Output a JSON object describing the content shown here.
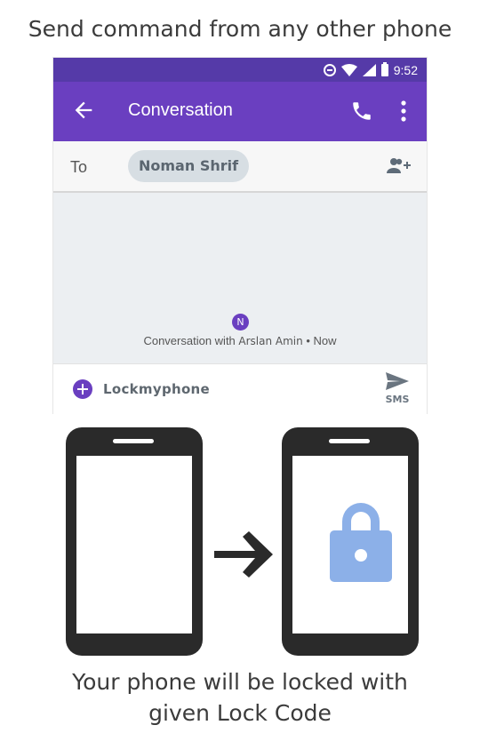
{
  "top_caption": "Send command from any other phone",
  "status_bar": {
    "time": "9:52"
  },
  "app_bar": {
    "title": "Conversation"
  },
  "recipient": {
    "to_label": "To",
    "chip_name": "Noman Shrif"
  },
  "conversation": {
    "avatar_initial": "N",
    "prefix": "Conversation with",
    "name": "Arslan Amin",
    "suffix": " • Now"
  },
  "compose": {
    "message": "Lockmyphone",
    "send_label": "SMS"
  },
  "bottom_caption": {
    "line1": "Your phone will be locked with",
    "line2": "given Lock Code"
  },
  "colors": {
    "status_bar": "#553aa8",
    "app_bar": "#6a3fc0",
    "lock": "#8cb0e8",
    "device": "#2a2a2a"
  },
  "icons": [
    "back-arrow-icon",
    "phone-icon",
    "more-vert-icon",
    "add-person-icon",
    "plus-icon",
    "send-icon",
    "right-arrow-icon",
    "padlock-icon"
  ]
}
